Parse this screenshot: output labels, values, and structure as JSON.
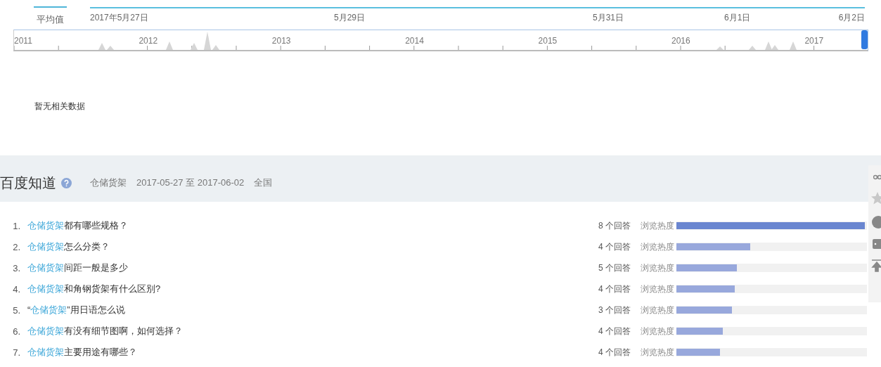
{
  "trend_tab": {
    "label": "平均值",
    "selected": true
  },
  "date_axis": [
    "2017年5月27日",
    "5月29日",
    "5月31日",
    "6月1日",
    "6月2日"
  ],
  "timeline": {
    "years": [
      "2011",
      "2012",
      "2013",
      "2014",
      "2015",
      "2016",
      "2017"
    ],
    "level": 1
  },
  "empty_message": "暂无相关数据",
  "zhidao": {
    "title": "百度知道",
    "keyword": "仓储货架",
    "date_range": "2017-05-27 至 2017-06-02",
    "region": "全国",
    "questions": [
      {
        "number": "1.",
        "keyword": "仓储货架",
        "rest": "都有哪些规格？",
        "answers": "8 个回答",
        "heat_label": "浏览热度",
        "level": 1,
        "top": true
      },
      {
        "number": "2.",
        "keyword": "仓储货架",
        "rest": "怎么分类？",
        "answers": "4 个回答",
        "heat_label": "浏览热度",
        "level": 0.39,
        "top": false
      },
      {
        "number": "3.",
        "keyword": "仓储货架",
        "rest": "间距一般是多少",
        "answers": "5 个回答",
        "heat_label": "浏览热度",
        "level": 0.32,
        "top": false
      },
      {
        "number": "4.",
        "keyword": "仓储货架",
        "rest": "和角钢货架有什么区别?",
        "answers": "4 个回答",
        "heat_label": "浏览热度",
        "level": 0.31,
        "top": false
      },
      {
        "number": "5.",
        "prefix": "“",
        "keyword": "仓储货架",
        "rest": "”用日语怎么说",
        "answers": "3 个回答",
        "heat_label": "浏览热度",
        "level": 0.295,
        "top": false
      },
      {
        "number": "6.",
        "keyword": "仓储货架",
        "rest": "有没有细节图啊，如何选择？",
        "answers": "4 个回答",
        "heat_label": "浏览热度",
        "level": 0.245,
        "top": false
      },
      {
        "number": "7.",
        "keyword": "仓储货架",
        "rest": "主要用途有哪些？",
        "answers": "4 个回答",
        "heat_label": "浏览热度",
        "level": 0.23,
        "top": false
      }
    ]
  }
}
